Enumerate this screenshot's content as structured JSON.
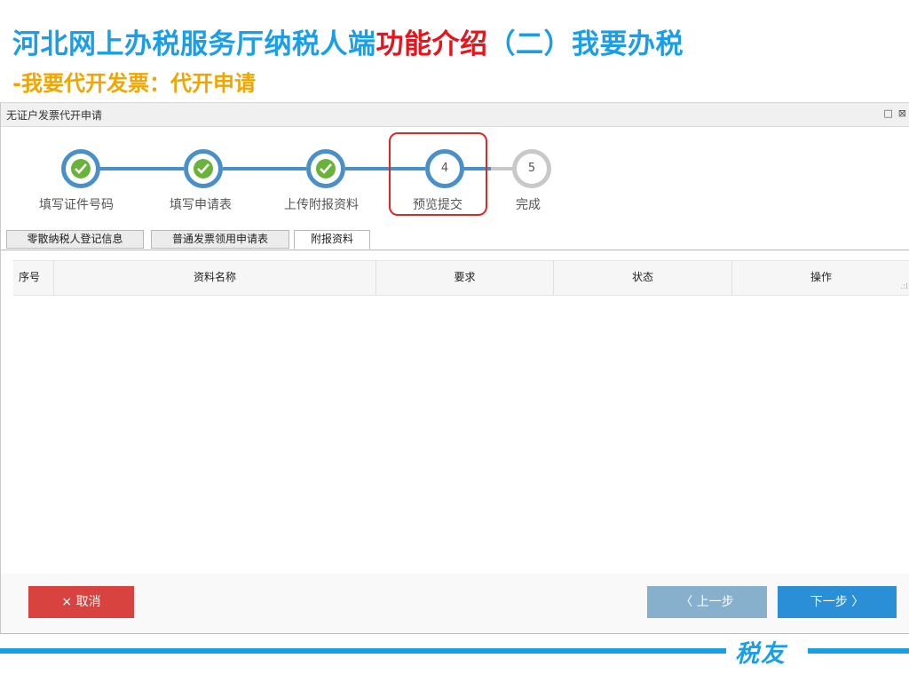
{
  "slide": {
    "title_blue": "河北网上办税服务厅纳税人端",
    "title_red": "功能介绍",
    "title_blue2": "（二）我要办税",
    "subtitle": "-我要代开发票：代开申请"
  },
  "window": {
    "title": "无证户发票代开申请",
    "controls": [
      "□",
      "⊠"
    ]
  },
  "steps": [
    {
      "label": "填写证件号码",
      "state": "done"
    },
    {
      "label": "填写申请表",
      "state": "done"
    },
    {
      "label": "上传附报资料",
      "state": "done"
    },
    {
      "label": "预览提交",
      "state": "active",
      "number": "4"
    },
    {
      "label": "完成",
      "state": "pending",
      "number": "5"
    }
  ],
  "tabs": [
    {
      "label": "零散纳税人登记信息",
      "active": false
    },
    {
      "label": "普通发票领用申请表",
      "active": false
    },
    {
      "label": "附报资料",
      "active": true
    }
  ],
  "table": {
    "columns": [
      "序号",
      "资料名称",
      "要求",
      "状态",
      "操作"
    ],
    "rows": []
  },
  "buttons": {
    "cancel": "× 取消",
    "prev": "〈 上一步",
    "next": "下一步 〉"
  },
  "brand": {
    "text": "税友"
  },
  "colors": {
    "brand_blue": "#1a9ee5",
    "title_red": "#e8141b",
    "subtitle_orange": "#f0a500",
    "step_blue": "#4a90c8",
    "check_green": "#69b33a",
    "cancel_red": "#d9433f",
    "next_blue": "#2a8fd6",
    "prev_blue": "#86b0cc"
  }
}
